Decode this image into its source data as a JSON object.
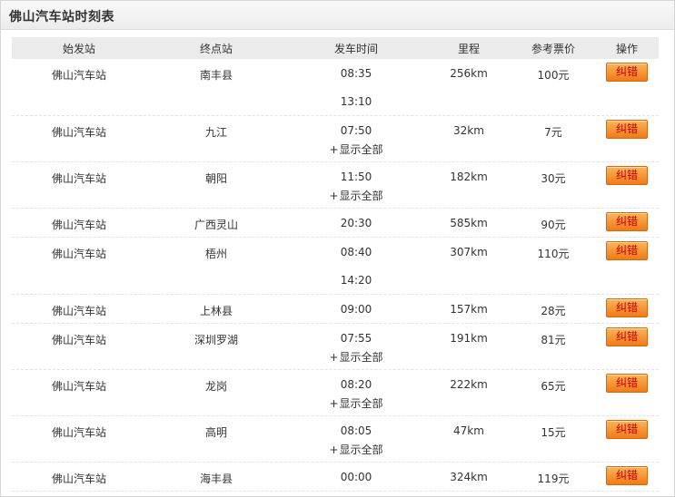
{
  "header": {
    "title": "佛山汽车站时刻表"
  },
  "columns": [
    "始发站",
    "终点站",
    "发车时间",
    "里程",
    "参考票价",
    "操作"
  ],
  "action_label": "纠错",
  "show_all_label": "显示全部",
  "rows": [
    {
      "from": "佛山汽车站",
      "to": "南丰县",
      "times": [
        "08:35",
        "13:10"
      ],
      "show_all": false,
      "distance": "256km",
      "price": "100元"
    },
    {
      "from": "佛山汽车站",
      "to": "九江",
      "times": [
        "07:50"
      ],
      "show_all": true,
      "distance": "32km",
      "price": "7元"
    },
    {
      "from": "佛山汽车站",
      "to": "朝阳",
      "times": [
        "11:50"
      ],
      "show_all": true,
      "distance": "182km",
      "price": "30元"
    },
    {
      "from": "佛山汽车站",
      "to": "广西灵山",
      "times": [
        "20:30"
      ],
      "show_all": false,
      "distance": "585km",
      "price": "90元"
    },
    {
      "from": "佛山汽车站",
      "to": "梧州",
      "times": [
        "08:40",
        "14:20"
      ],
      "show_all": false,
      "distance": "307km",
      "price": "110元"
    },
    {
      "from": "佛山汽车站",
      "to": "上林县",
      "times": [
        "09:00"
      ],
      "show_all": false,
      "distance": "157km",
      "price": "28元"
    },
    {
      "from": "佛山汽车站",
      "to": "深圳罗湖",
      "times": [
        "07:55"
      ],
      "show_all": true,
      "distance": "191km",
      "price": "81元"
    },
    {
      "from": "佛山汽车站",
      "to": "龙岗",
      "times": [
        "08:20"
      ],
      "show_all": true,
      "distance": "222km",
      "price": "65元"
    },
    {
      "from": "佛山汽车站",
      "to": "高明",
      "times": [
        "08:05"
      ],
      "show_all": true,
      "distance": "47km",
      "price": "15元"
    },
    {
      "from": "佛山汽车站",
      "to": "海丰县",
      "times": [
        "00:00"
      ],
      "show_all": false,
      "distance": "324km",
      "price": "119元"
    }
  ]
}
